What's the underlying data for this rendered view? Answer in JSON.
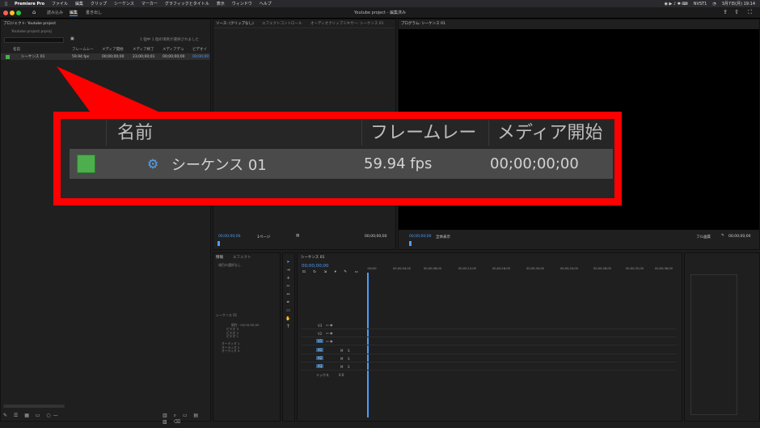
{
  "menubar": {
    "app": "Premiere Pro",
    "items": [
      "ファイル",
      "編集",
      "クリップ",
      "シーケンス",
      "マーカー",
      "グラフィックとタイトル",
      "表示",
      "ウィンドウ",
      "ヘルプ"
    ],
    "status": "NVST1",
    "datetime": "3月7日(月) 19:14"
  },
  "window": {
    "title": "Youtube project - 編集済み",
    "workspaces": [
      "読み込み",
      "編集",
      "書き出し"
    ]
  },
  "project": {
    "tab": "プロジェクト: Youtube project",
    "file": "Youtube project.prproj",
    "selection": "1 個中 1 個の項目が選択されました",
    "columns": [
      "名前",
      "フレームレー",
      "メディア開始",
      "メディア終了",
      "メディアデュ",
      "ビデオイ"
    ],
    "row": {
      "name": "シーケンス 01",
      "fps": "59.94 fps",
      "start": "00;00;00;00",
      "end": "23;00;00;01",
      "dur": "00;00;00;00",
      "extra": "00;00;00"
    }
  },
  "source": {
    "tabs": [
      "ソース: (クリップなし)",
      "エフェクトコントロール",
      "オーディオクリップミキサー: シーケンス 01"
    ],
    "timecode": "00;00;00;00",
    "page": "1ページ",
    "end": "00;00;00;00"
  },
  "program": {
    "tab": "プログラム: シーケンス 01",
    "timecode": "00;00;00;00",
    "fit": "全体表示",
    "quality": "フル画質",
    "end": "00;00;00;00"
  },
  "info": {
    "tabs": [
      "情報",
      "エフェクト"
    ],
    "no_selection": "項目の選択なし",
    "sequence": "シーケンス 01",
    "current": "現在 : 00;00;00;00",
    "video": [
      "ビデオ 3",
      "ビデオ 2",
      "ビデオ 1"
    ],
    "audio": [
      "オーディオ 1",
      "オーディオ 2",
      "オーディオ 3"
    ]
  },
  "timeline": {
    "tab": "シーケンス 01",
    "timecode": "00;00;00;00",
    "ruler": [
      ":00;00",
      "00;00;04;00",
      "00;00;08;00",
      "00;00;12;00",
      "00;00;16;00",
      "00;00;20;00",
      "00;00;24;00",
      "00;00;28;00",
      "00;00;32;00",
      "00;00;36;00"
    ],
    "video_tracks": [
      "V3",
      "V2",
      "V1"
    ],
    "audio_tracks": [
      "A1",
      "A2",
      "A3"
    ],
    "mix": "ミックス",
    "mix_value": "0.0",
    "track_buttons": [
      "M",
      "S"
    ]
  },
  "callout": {
    "col_name": "名前",
    "col_fps": "フレームレー",
    "col_start": "メディア開始",
    "row_name": "シーケンス 01",
    "row_fps": "59.94 fps",
    "row_start": "00;00;00;00"
  },
  "colors": {
    "label_green": "#4cae4c",
    "highlight_red": "#ff0000",
    "accent_blue": "#4d9cf8"
  }
}
